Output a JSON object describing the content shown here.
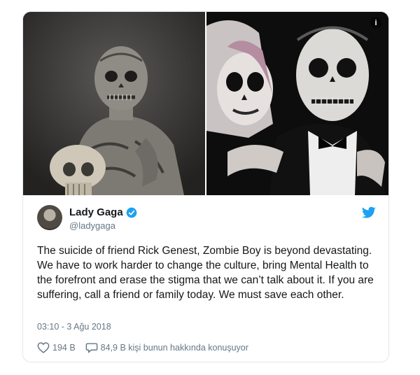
{
  "tweet": {
    "author_name": "Lady Gaga",
    "handle": "@ladygaga",
    "text": "The suicide of friend Rick Genest, Zombie Boy is beyond devastating. We have to work harder to change the culture, bring Mental Health to the forefront and erase the stigma that we can’t talk about it. If you are suffering, call a friend or family today. We must save each other.",
    "timestamp": "03:10 - 3 Ağu 2018",
    "likes": "194 B",
    "replies": "84,9 B kişi bunun hakkında konuşuyor",
    "info_symbol": "i"
  },
  "icons": {
    "verified": "verified-badge-icon",
    "platform": "twitter-bird-icon",
    "like": "heart-icon",
    "reply": "speech-bubble-icon",
    "info": "info-icon"
  },
  "colors": {
    "twitter_blue": "#1da1f2",
    "text": "#14171a",
    "muted": "#657786",
    "border": "#e1e8ed"
  }
}
